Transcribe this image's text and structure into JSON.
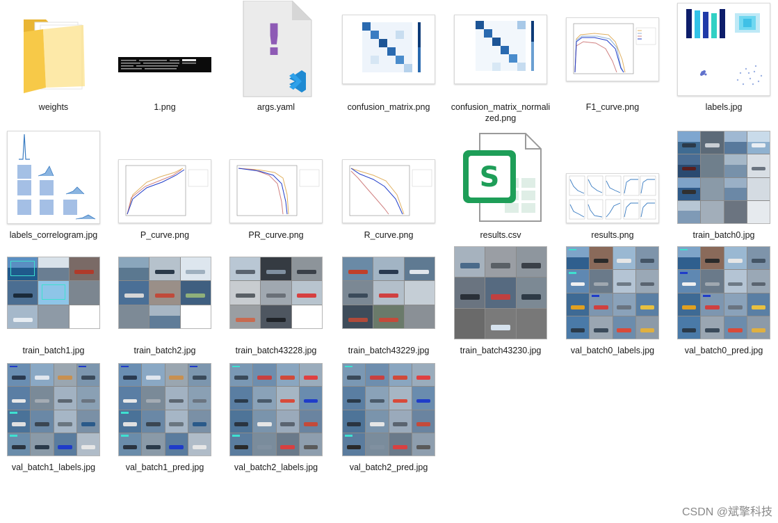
{
  "files": [
    {
      "name": "weights",
      "kind": "folder"
    },
    {
      "name": "1.png",
      "kind": "terminal-image"
    },
    {
      "name": "args.yaml",
      "kind": "yaml"
    },
    {
      "name": "confusion_matrix.png",
      "kind": "matrix-image"
    },
    {
      "name": "confusion_matrix_normalized.png",
      "kind": "matrix-image"
    },
    {
      "name": "F1_curve.png",
      "kind": "curve-image"
    },
    {
      "name": "labels.jpg",
      "kind": "labels-image"
    },
    {
      "name": "labels_correlogram.jpg",
      "kind": "correlogram-image"
    },
    {
      "name": "P_curve.png",
      "kind": "curve-image"
    },
    {
      "name": "PR_curve.png",
      "kind": "curve-image"
    },
    {
      "name": "R_curve.png",
      "kind": "curve-image"
    },
    {
      "name": "results.csv",
      "kind": "csv"
    },
    {
      "name": "results.png",
      "kind": "results-image"
    },
    {
      "name": "train_batch0.jpg",
      "kind": "photo-grid"
    },
    {
      "name": "train_batch1.jpg",
      "kind": "photo-grid"
    },
    {
      "name": "train_batch2.jpg",
      "kind": "photo-grid"
    },
    {
      "name": "train_batch43228.jpg",
      "kind": "photo-grid"
    },
    {
      "name": "train_batch43229.jpg",
      "kind": "photo-grid"
    },
    {
      "name": "train_batch43230.jpg",
      "kind": "photo-grid"
    },
    {
      "name": "val_batch0_labels.jpg",
      "kind": "photo-grid"
    },
    {
      "name": "val_batch0_pred.jpg",
      "kind": "photo-grid"
    },
    {
      "name": "val_batch1_labels.jpg",
      "kind": "photo-grid"
    },
    {
      "name": "val_batch1_pred.jpg",
      "kind": "photo-grid"
    },
    {
      "name": "val_batch2_labels.jpg",
      "kind": "photo-grid"
    },
    {
      "name": "val_batch2_pred.jpg",
      "kind": "photo-grid"
    }
  ],
  "watermark": "CSDN @斌擎科技",
  "colors": {
    "folder": "#f5c342",
    "folder_dark": "#e0a92a",
    "vscode_blue": "#1f8ad2",
    "yaml_mark": "#8e5ab5",
    "sheets_green": "#1e9e58",
    "matrix_blue": "#2a6ab0",
    "curve_blue": "#1f3cc9",
    "tag_cyan": "#3fe0d0"
  }
}
